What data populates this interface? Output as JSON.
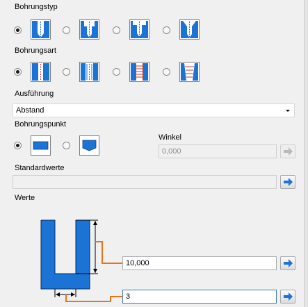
{
  "bohrungstyp": {
    "label": "Bohrungstyp",
    "selected_index": 0,
    "options": [
      {
        "icon": "drill-type-1-icon"
      },
      {
        "icon": "drill-type-2-icon"
      },
      {
        "icon": "drill-type-3-icon"
      },
      {
        "icon": "drill-type-4-icon"
      }
    ]
  },
  "bohrungsart": {
    "label": "Bohrungsart",
    "selected_index": 0,
    "options": [
      {
        "icon": "hole-simple-icon"
      },
      {
        "icon": "hole-threaded-icon"
      },
      {
        "icon": "hole-ladder-icon"
      },
      {
        "icon": "hole-tapered-thread-icon"
      }
    ]
  },
  "ausfuehrung": {
    "label": "Ausführung",
    "value": "Abstand"
  },
  "bohrungspunkt": {
    "label": "Bohrungspunkt",
    "selected_index": 0,
    "options": [
      {
        "icon": "flat-bottom-icon"
      },
      {
        "icon": "cone-bottom-icon"
      }
    ]
  },
  "winkel": {
    "label": "Winkel",
    "value": "0,000"
  },
  "standardwerte": {
    "label": "Standardwerte",
    "value": ""
  },
  "werte": {
    "label": "Werte",
    "depth_value": "10,000",
    "width_value": "3"
  },
  "colors": {
    "accent_blue": "#1b73d6",
    "orange": "#e8741a",
    "field_border": "#abadb3"
  }
}
